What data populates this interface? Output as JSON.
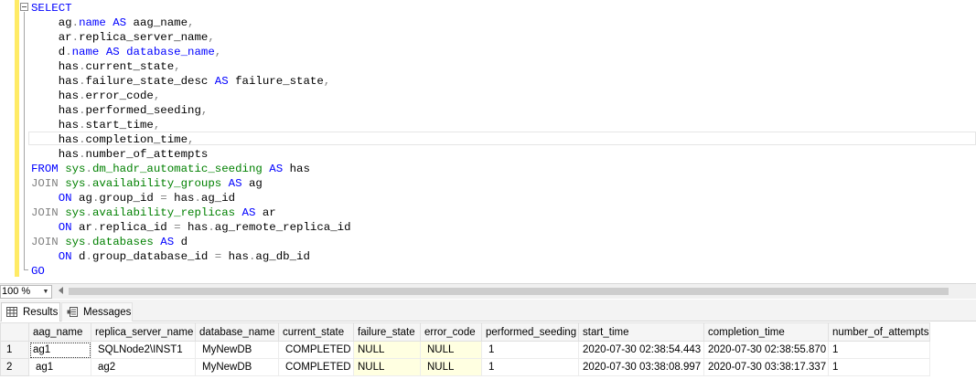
{
  "editor": {
    "lines": [
      [
        [
          "kw",
          "SELECT"
        ]
      ],
      [
        [
          "tx",
          "    ag"
        ],
        [
          "gr",
          "."
        ],
        [
          "kw",
          "name"
        ],
        [
          "tx",
          " "
        ],
        [
          "kw",
          "AS"
        ],
        [
          "tx",
          " aag_name"
        ],
        [
          "gr",
          ","
        ]
      ],
      [
        [
          "tx",
          "    ar"
        ],
        [
          "gr",
          "."
        ],
        [
          "tx",
          "replica_server_name"
        ],
        [
          "gr",
          ","
        ]
      ],
      [
        [
          "tx",
          "    d"
        ],
        [
          "gr",
          "."
        ],
        [
          "kw",
          "name"
        ],
        [
          "tx",
          " "
        ],
        [
          "kw",
          "AS"
        ],
        [
          "tx",
          " "
        ],
        [
          "kw",
          "database_name"
        ],
        [
          "gr",
          ","
        ]
      ],
      [
        [
          "tx",
          "    has"
        ],
        [
          "gr",
          "."
        ],
        [
          "tx",
          "current_state"
        ],
        [
          "gr",
          ","
        ]
      ],
      [
        [
          "tx",
          "    has"
        ],
        [
          "gr",
          "."
        ],
        [
          "tx",
          "failure_state_desc"
        ],
        [
          "tx",
          " "
        ],
        [
          "kw",
          "AS"
        ],
        [
          "tx",
          " failure_state"
        ],
        [
          "gr",
          ","
        ]
      ],
      [
        [
          "tx",
          "    has"
        ],
        [
          "gr",
          "."
        ],
        [
          "tx",
          "error_code"
        ],
        [
          "gr",
          ","
        ]
      ],
      [
        [
          "tx",
          "    has"
        ],
        [
          "gr",
          "."
        ],
        [
          "tx",
          "performed_seeding"
        ],
        [
          "gr",
          ","
        ]
      ],
      [
        [
          "tx",
          "    has"
        ],
        [
          "gr",
          "."
        ],
        [
          "tx",
          "start_time"
        ],
        [
          "gr",
          ","
        ]
      ],
      [
        [
          "tx",
          "    has"
        ],
        [
          "gr",
          "."
        ],
        [
          "tx",
          "completion_time"
        ],
        [
          "gr",
          ","
        ]
      ],
      [
        [
          "tx",
          "    has"
        ],
        [
          "gr",
          "."
        ],
        [
          "tx",
          "number_of_attempts"
        ]
      ],
      [
        [
          "kw",
          "FROM"
        ],
        [
          "tx",
          " "
        ],
        [
          "sys",
          "sys"
        ],
        [
          "gr",
          "."
        ],
        [
          "sys",
          "dm_hadr_automatic_seeding"
        ],
        [
          "tx",
          " "
        ],
        [
          "kw",
          "AS"
        ],
        [
          "tx",
          " has"
        ]
      ],
      [
        [
          "gr",
          "JOIN"
        ],
        [
          "tx",
          " "
        ],
        [
          "sys",
          "sys"
        ],
        [
          "gr",
          "."
        ],
        [
          "sys",
          "availability_groups"
        ],
        [
          "tx",
          " "
        ],
        [
          "kw",
          "AS"
        ],
        [
          "tx",
          " ag"
        ]
      ],
      [
        [
          "tx",
          "    "
        ],
        [
          "kw",
          "ON"
        ],
        [
          "tx",
          " ag"
        ],
        [
          "gr",
          "."
        ],
        [
          "tx",
          "group_id "
        ],
        [
          "gr",
          "="
        ],
        [
          "tx",
          " has"
        ],
        [
          "gr",
          "."
        ],
        [
          "tx",
          "ag_id"
        ]
      ],
      [
        [
          "gr",
          "JOIN"
        ],
        [
          "tx",
          " "
        ],
        [
          "sys",
          "sys"
        ],
        [
          "gr",
          "."
        ],
        [
          "sys",
          "availability_replicas"
        ],
        [
          "tx",
          " "
        ],
        [
          "kw",
          "AS"
        ],
        [
          "tx",
          " ar"
        ]
      ],
      [
        [
          "tx",
          "    "
        ],
        [
          "kw",
          "ON"
        ],
        [
          "tx",
          " ar"
        ],
        [
          "gr",
          "."
        ],
        [
          "tx",
          "replica_id "
        ],
        [
          "gr",
          "="
        ],
        [
          "tx",
          " has"
        ],
        [
          "gr",
          "."
        ],
        [
          "tx",
          "ag_remote_replica_id"
        ]
      ],
      [
        [
          "gr",
          "JOIN"
        ],
        [
          "tx",
          " "
        ],
        [
          "sys",
          "sys"
        ],
        [
          "gr",
          "."
        ],
        [
          "sys",
          "databases"
        ],
        [
          "tx",
          " "
        ],
        [
          "kw",
          "AS"
        ],
        [
          "tx",
          " d"
        ]
      ],
      [
        [
          "tx",
          "    "
        ],
        [
          "kw",
          "ON"
        ],
        [
          "tx",
          " d"
        ],
        [
          "gr",
          "."
        ],
        [
          "tx",
          "group_database_id "
        ],
        [
          "gr",
          "="
        ],
        [
          "tx",
          " has"
        ],
        [
          "gr",
          "."
        ],
        [
          "tx",
          "ag_db_id"
        ]
      ],
      [
        [
          "kw",
          "GO"
        ]
      ]
    ]
  },
  "zoom": {
    "value": "100 %"
  },
  "tabs": {
    "results": "Results",
    "messages": "Messages"
  },
  "grid": {
    "columns": [
      "aag_name",
      "replica_server_name",
      "database_name",
      "current_state",
      "failure_state",
      "error_code",
      "performed_seeding",
      "start_time",
      "completion_time",
      "number_of_attempts"
    ],
    "rows": [
      {
        "num": "1",
        "cells": [
          "ag1",
          "SQLNode2\\INST1",
          "MyNewDB",
          "COMPLETED",
          "NULL",
          "NULL",
          "1",
          "2020-07-30 02:38:54.443",
          "2020-07-30 02:38:55.870",
          "1"
        ]
      },
      {
        "num": "2",
        "cells": [
          "ag1",
          "ag2",
          "MyNewDB",
          "COMPLETED",
          "NULL",
          "NULL",
          "1",
          "2020-07-30 03:38:08.997",
          "2020-07-30 03:38:17.337",
          "1"
        ]
      }
    ]
  },
  "colors": {
    "keyword": "#0000ff",
    "operator": "#808080",
    "system_object": "#008000",
    "null_cell": "#ffffe1",
    "modified_margin": "#ffeb66"
  }
}
